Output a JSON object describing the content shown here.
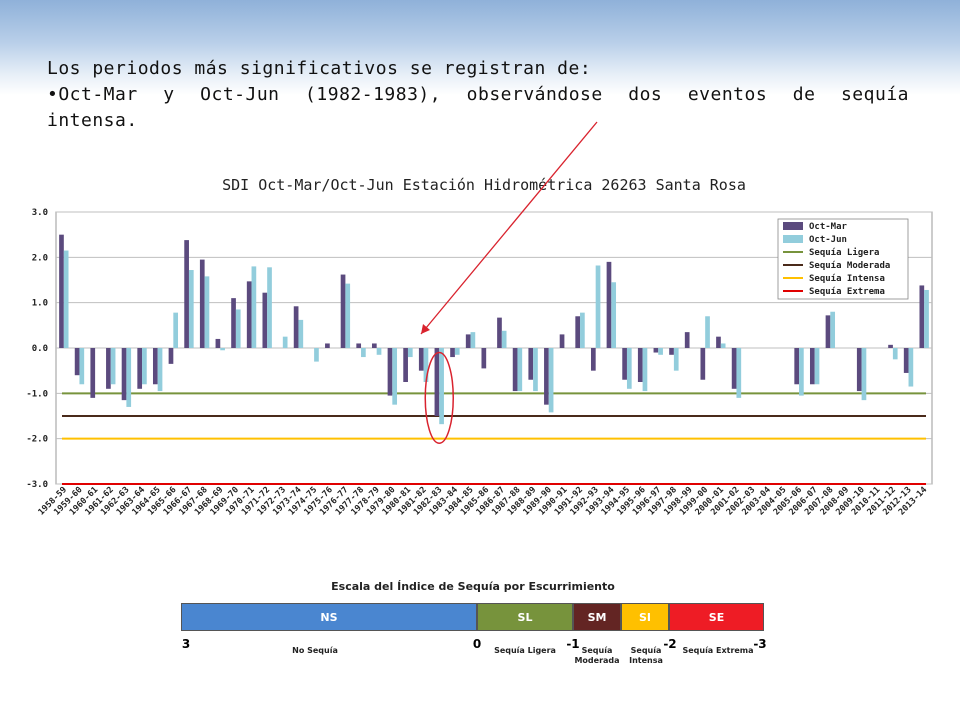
{
  "intro": {
    "line1": "Los periodos más significativos se registran de:",
    "line2": "•Oct-Mar y Oct-Jun (1982-1983), observándose dos eventos de sequía",
    "line3": "intensa."
  },
  "chart_data": {
    "type": "bar",
    "title": "SDI Oct-Mar/Oct-Jun Estación Hidrométrica 26263 Santa Rosa",
    "ylim": [
      -3.0,
      3.0
    ],
    "yticks": [
      "3.0",
      "2.0",
      "1.0",
      "0.0",
      "-1.0",
      "-2.0",
      "-3.0"
    ],
    "grid": true,
    "legend_position": "top-right",
    "categories": [
      "1958-59",
      "1959-60",
      "1960-61",
      "1961-62",
      "1962-63",
      "1963-64",
      "1964-65",
      "1965-66",
      "1966-67",
      "1967-68",
      "1968-69",
      "1969-70",
      "1970-71",
      "1971-72",
      "1972-73",
      "1973-74",
      "1974-75",
      "1975-76",
      "1976-77",
      "1977-78",
      "1978-79",
      "1979-80",
      "1980-81",
      "1981-82",
      "1982-83",
      "1983-84",
      "1984-85",
      "1985-86",
      "1986-87",
      "1987-88",
      "1988-89",
      "1989-90",
      "1990-91",
      "1991-92",
      "1992-93",
      "1993-94",
      "1994-95",
      "1995-96",
      "1996-97",
      "1997-98",
      "1998-99",
      "1999-00",
      "2000-01",
      "2001-02",
      "2002-03",
      "2003-04",
      "2004-05",
      "2005-06",
      "2006-07",
      "2007-08",
      "2008-09",
      "2009-10",
      "2010-11",
      "2011-12",
      "2012-13",
      "2013-14"
    ],
    "series": [
      {
        "name": "Oct-Mar",
        "color": "#5b4a7e",
        "values": [
          2.5,
          -0.6,
          -1.1,
          -0.9,
          -1.15,
          -0.9,
          -0.8,
          -0.35,
          2.38,
          1.95,
          0.2,
          1.1,
          1.47,
          1.22,
          0.0,
          0.92,
          0.0,
          0.1,
          1.62,
          0.1,
          0.1,
          -1.05,
          -0.75,
          -0.5,
          -1.5,
          -0.2,
          0.3,
          -0.45,
          0.67,
          -0.95,
          -0.7,
          -1.25,
          0.3,
          0.7,
          -0.5,
          1.9,
          -0.7,
          -0.75,
          -0.1,
          -0.15,
          0.35,
          -0.7,
          0.25,
          -0.9,
          0.0,
          0.0,
          0.0,
          -0.8,
          -0.8,
          0.72,
          0.0,
          -0.95,
          0.0,
          0.07,
          -0.55,
          1.38
        ]
      },
      {
        "name": "Oct-Jun",
        "color": "#92cddc",
        "values": [
          2.15,
          -0.8,
          0.0,
          -0.8,
          -1.3,
          -0.8,
          -0.95,
          0.78,
          1.72,
          1.58,
          -0.05,
          0.85,
          1.8,
          1.78,
          0.25,
          0.62,
          -0.3,
          0.0,
          1.42,
          -0.2,
          -0.15,
          -1.25,
          -0.2,
          -0.75,
          -1.68,
          -0.15,
          0.35,
          0.0,
          0.38,
          -0.95,
          -0.95,
          -1.42,
          0.0,
          0.78,
          1.82,
          1.45,
          -0.9,
          -0.95,
          -0.15,
          -0.5,
          0.0,
          0.7,
          0.1,
          -1.1,
          0.0,
          0.0,
          0.0,
          -1.05,
          -0.8,
          0.8,
          0.0,
          -1.15,
          0.0,
          -0.25,
          -0.85,
          1.28
        ]
      }
    ],
    "thresholds": [
      {
        "name": "Sequía Ligera",
        "value": -1.0,
        "color": "#77933c"
      },
      {
        "name": "Sequía Moderada",
        "value": -1.5,
        "color": "#4a2a1a"
      },
      {
        "name": "Sequía Intensa",
        "value": -2.0,
        "color": "#ffc000"
      },
      {
        "name": "Sequía Extrema",
        "value": -3.0,
        "color": "#e00000"
      }
    ],
    "highlight_category": "1982-83"
  },
  "scale": {
    "title": "Escala del Índice de Sequía por Escurrimiento",
    "segments": [
      {
        "code": "NS",
        "color": "#4a86d0",
        "text_color": "#ffffff",
        "from": 3,
        "to": 0
      },
      {
        "code": "SL",
        "color": "#77933c",
        "text_color": "#ffffff",
        "from": 0,
        "to": -1
      },
      {
        "code": "SM",
        "color": "#632523",
        "text_color": "#ffffff",
        "from": -1,
        "to": -1.5
      },
      {
        "code": "SI",
        "color": "#ffc000",
        "text_color": "#ffffff",
        "from": -1.5,
        "to": -2
      },
      {
        "code": "SE",
        "color": "#ee1c25",
        "text_color": "#ffffff",
        "from": -2,
        "to": -3
      }
    ],
    "ticks": [
      "3",
      "0",
      "-1",
      "-2",
      "-3"
    ],
    "labels": {
      "ns": "No Sequía",
      "sl": "Sequía Ligera",
      "sm_1": "Sequía",
      "sm_2": "Moderada",
      "si_1": "Sequía",
      "si_2": "Intensa",
      "se": "Sequía Extrema"
    }
  }
}
